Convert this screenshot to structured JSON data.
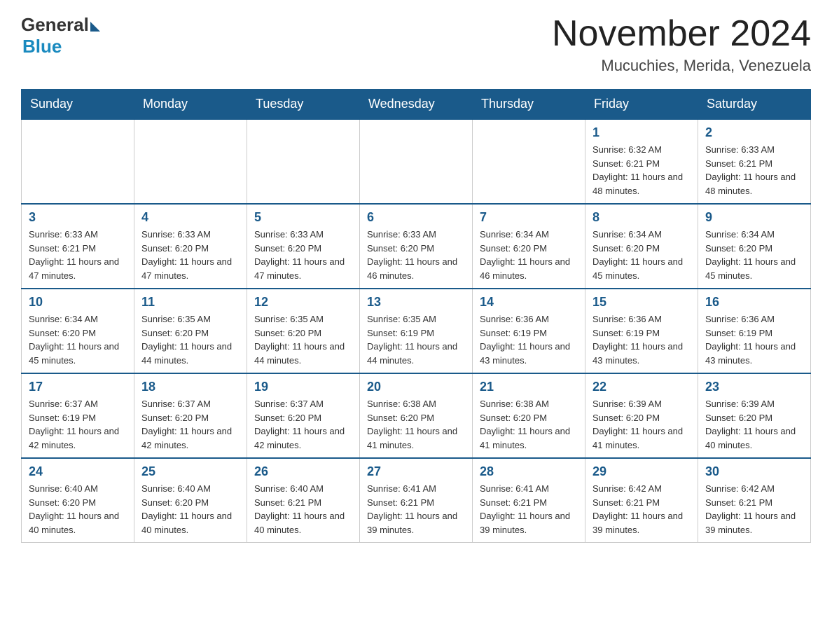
{
  "logo": {
    "general": "General",
    "blue": "Blue"
  },
  "title": "November 2024",
  "location": "Mucuchies, Merida, Venezuela",
  "days_of_week": [
    "Sunday",
    "Monday",
    "Tuesday",
    "Wednesday",
    "Thursday",
    "Friday",
    "Saturday"
  ],
  "weeks": [
    [
      {
        "day": "",
        "info": ""
      },
      {
        "day": "",
        "info": ""
      },
      {
        "day": "",
        "info": ""
      },
      {
        "day": "",
        "info": ""
      },
      {
        "day": "",
        "info": ""
      },
      {
        "day": "1",
        "info": "Sunrise: 6:32 AM\nSunset: 6:21 PM\nDaylight: 11 hours and 48 minutes."
      },
      {
        "day": "2",
        "info": "Sunrise: 6:33 AM\nSunset: 6:21 PM\nDaylight: 11 hours and 48 minutes."
      }
    ],
    [
      {
        "day": "3",
        "info": "Sunrise: 6:33 AM\nSunset: 6:21 PM\nDaylight: 11 hours and 47 minutes."
      },
      {
        "day": "4",
        "info": "Sunrise: 6:33 AM\nSunset: 6:20 PM\nDaylight: 11 hours and 47 minutes."
      },
      {
        "day": "5",
        "info": "Sunrise: 6:33 AM\nSunset: 6:20 PM\nDaylight: 11 hours and 47 minutes."
      },
      {
        "day": "6",
        "info": "Sunrise: 6:33 AM\nSunset: 6:20 PM\nDaylight: 11 hours and 46 minutes."
      },
      {
        "day": "7",
        "info": "Sunrise: 6:34 AM\nSunset: 6:20 PM\nDaylight: 11 hours and 46 minutes."
      },
      {
        "day": "8",
        "info": "Sunrise: 6:34 AM\nSunset: 6:20 PM\nDaylight: 11 hours and 45 minutes."
      },
      {
        "day": "9",
        "info": "Sunrise: 6:34 AM\nSunset: 6:20 PM\nDaylight: 11 hours and 45 minutes."
      }
    ],
    [
      {
        "day": "10",
        "info": "Sunrise: 6:34 AM\nSunset: 6:20 PM\nDaylight: 11 hours and 45 minutes."
      },
      {
        "day": "11",
        "info": "Sunrise: 6:35 AM\nSunset: 6:20 PM\nDaylight: 11 hours and 44 minutes."
      },
      {
        "day": "12",
        "info": "Sunrise: 6:35 AM\nSunset: 6:20 PM\nDaylight: 11 hours and 44 minutes."
      },
      {
        "day": "13",
        "info": "Sunrise: 6:35 AM\nSunset: 6:19 PM\nDaylight: 11 hours and 44 minutes."
      },
      {
        "day": "14",
        "info": "Sunrise: 6:36 AM\nSunset: 6:19 PM\nDaylight: 11 hours and 43 minutes."
      },
      {
        "day": "15",
        "info": "Sunrise: 6:36 AM\nSunset: 6:19 PM\nDaylight: 11 hours and 43 minutes."
      },
      {
        "day": "16",
        "info": "Sunrise: 6:36 AM\nSunset: 6:19 PM\nDaylight: 11 hours and 43 minutes."
      }
    ],
    [
      {
        "day": "17",
        "info": "Sunrise: 6:37 AM\nSunset: 6:19 PM\nDaylight: 11 hours and 42 minutes."
      },
      {
        "day": "18",
        "info": "Sunrise: 6:37 AM\nSunset: 6:20 PM\nDaylight: 11 hours and 42 minutes."
      },
      {
        "day": "19",
        "info": "Sunrise: 6:37 AM\nSunset: 6:20 PM\nDaylight: 11 hours and 42 minutes."
      },
      {
        "day": "20",
        "info": "Sunrise: 6:38 AM\nSunset: 6:20 PM\nDaylight: 11 hours and 41 minutes."
      },
      {
        "day": "21",
        "info": "Sunrise: 6:38 AM\nSunset: 6:20 PM\nDaylight: 11 hours and 41 minutes."
      },
      {
        "day": "22",
        "info": "Sunrise: 6:39 AM\nSunset: 6:20 PM\nDaylight: 11 hours and 41 minutes."
      },
      {
        "day": "23",
        "info": "Sunrise: 6:39 AM\nSunset: 6:20 PM\nDaylight: 11 hours and 40 minutes."
      }
    ],
    [
      {
        "day": "24",
        "info": "Sunrise: 6:40 AM\nSunset: 6:20 PM\nDaylight: 11 hours and 40 minutes."
      },
      {
        "day": "25",
        "info": "Sunrise: 6:40 AM\nSunset: 6:20 PM\nDaylight: 11 hours and 40 minutes."
      },
      {
        "day": "26",
        "info": "Sunrise: 6:40 AM\nSunset: 6:21 PM\nDaylight: 11 hours and 40 minutes."
      },
      {
        "day": "27",
        "info": "Sunrise: 6:41 AM\nSunset: 6:21 PM\nDaylight: 11 hours and 39 minutes."
      },
      {
        "day": "28",
        "info": "Sunrise: 6:41 AM\nSunset: 6:21 PM\nDaylight: 11 hours and 39 minutes."
      },
      {
        "day": "29",
        "info": "Sunrise: 6:42 AM\nSunset: 6:21 PM\nDaylight: 11 hours and 39 minutes."
      },
      {
        "day": "30",
        "info": "Sunrise: 6:42 AM\nSunset: 6:21 PM\nDaylight: 11 hours and 39 minutes."
      }
    ]
  ]
}
